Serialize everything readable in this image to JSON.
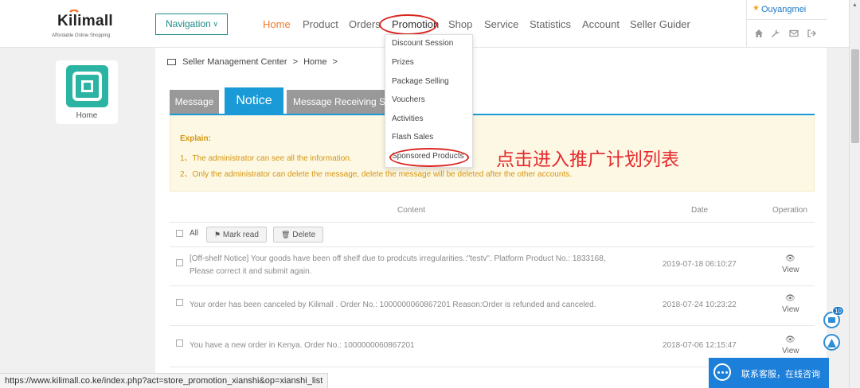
{
  "colors": {
    "accent": "#1a9ad6",
    "active_menu": "#f07a2d",
    "highlight": "#d9251d",
    "teal": "#1d8a8a"
  },
  "logo": {
    "name": "Kilimall",
    "tagline": "Affordable Online Shopping"
  },
  "nav_select": {
    "label": "Navigation",
    "icon": "chevron-down-icon"
  },
  "menu": [
    "Home",
    "Product",
    "Orders",
    "Promotion",
    "Shop",
    "Service",
    "Statistics",
    "Account",
    "Seller Guider"
  ],
  "user": {
    "name": "Ouyangmei",
    "icons": [
      "home-icon",
      "wrench-icon",
      "mail-icon",
      "logout-icon"
    ]
  },
  "sidebar": {
    "home_label": "Home"
  },
  "breadcrumb": {
    "root": "Seller Management Center",
    "sep": ">",
    "current": "Home"
  },
  "tabs": [
    "Message",
    "Notice",
    "Message Receiving Settings"
  ],
  "explain": {
    "title": "Explain:",
    "lines": [
      "1、The administrator can see all the information.",
      "2、Only the administrator can delete the message, delete the message will be deleted after the other accounts."
    ]
  },
  "table": {
    "headers": {
      "content": "Content",
      "date": "Date",
      "operation": "Operation"
    },
    "all_label": "All",
    "mark_read": "Mark read",
    "delete": "Delete",
    "view_label": "View",
    "rows": [
      {
        "line1": "[Off-shelf Notice] Your goods have been off shelf due to prodcuts irregularities.:\"testv\". Platform Product No.: 1833168,",
        "line2": "Please correct it and submit again.",
        "date": "2019-07-18 06:10:27"
      },
      {
        "line1": "Your order has been canceled by Kilimall . Order No.: 1000000060867201 Reason:Order is refunded and canceled.",
        "date": "2018-07-24 10:23:22"
      },
      {
        "line1": "You have a new order in Kenya. Order No.: 1000000060867201",
        "date": "2018-07-06 12:15:47"
      }
    ]
  },
  "dropdown": [
    "Discount Session",
    "Prizes",
    "Package Selling",
    "Vouchers",
    "Activities",
    "Flash Sales",
    "Sponsored Products"
  ],
  "annotation": "点击进入推广计划列表",
  "float_badge": "10",
  "chat": {
    "text": "联系客服，在线咨询"
  },
  "status_url": "https://www.kilimall.co.ke/index.php?act=store_promotion_xianshi&op=xianshi_list"
}
